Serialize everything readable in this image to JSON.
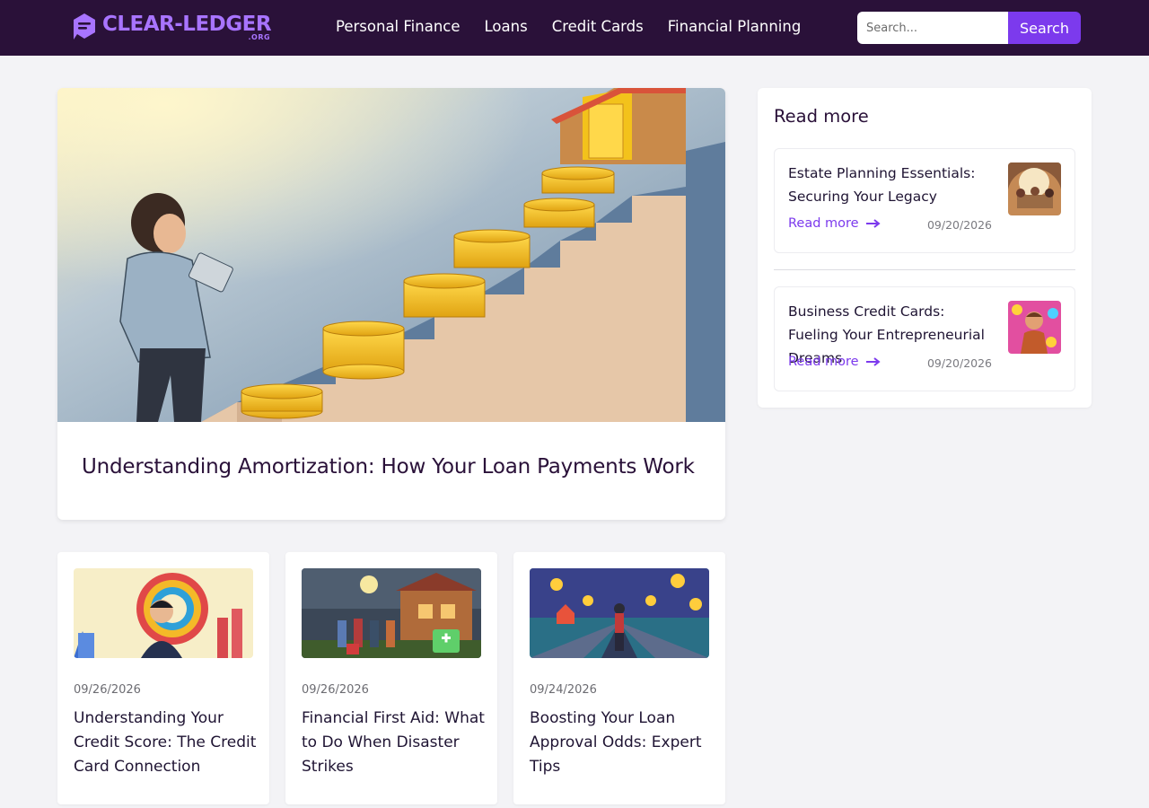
{
  "header": {
    "logo_text": "CLEAR-LEDGER",
    "logo_sub": ".ORG",
    "nav": [
      "Personal Finance",
      "Loans",
      "Credit Cards",
      "Financial Planning"
    ],
    "search_placeholder": "Search...",
    "search_button": "Search"
  },
  "hero": {
    "title": "Understanding Amortization: How Your Loan Payments Work",
    "image_icon": "coin-staircase-illustration"
  },
  "sidebar": {
    "heading": "Read more",
    "items": [
      {
        "title": "Estate Planning Essentials: Securing Your Legacy",
        "read_more": "Read more",
        "date": "09/20/2026"
      },
      {
        "title": "Business Credit Cards: Fueling Your Entrepreneurial Dreams",
        "read_more": "Read more",
        "date": "09/20/2026"
      }
    ]
  },
  "articles": [
    {
      "date": "09/26/2026",
      "title": "Understanding Your Credit Score: The Credit Card Connection"
    },
    {
      "date": "09/26/2026",
      "title": "Financial First Aid: What to Do When Disaster Strikes"
    },
    {
      "date": "09/24/2026",
      "title": "Boosting Your Loan Approval Odds: Expert Tips"
    }
  ],
  "colors": {
    "header_bg": "#2a1139",
    "accent": "#7c3aed",
    "logo": "#a874ff",
    "page_bg": "#f3f3f6"
  }
}
